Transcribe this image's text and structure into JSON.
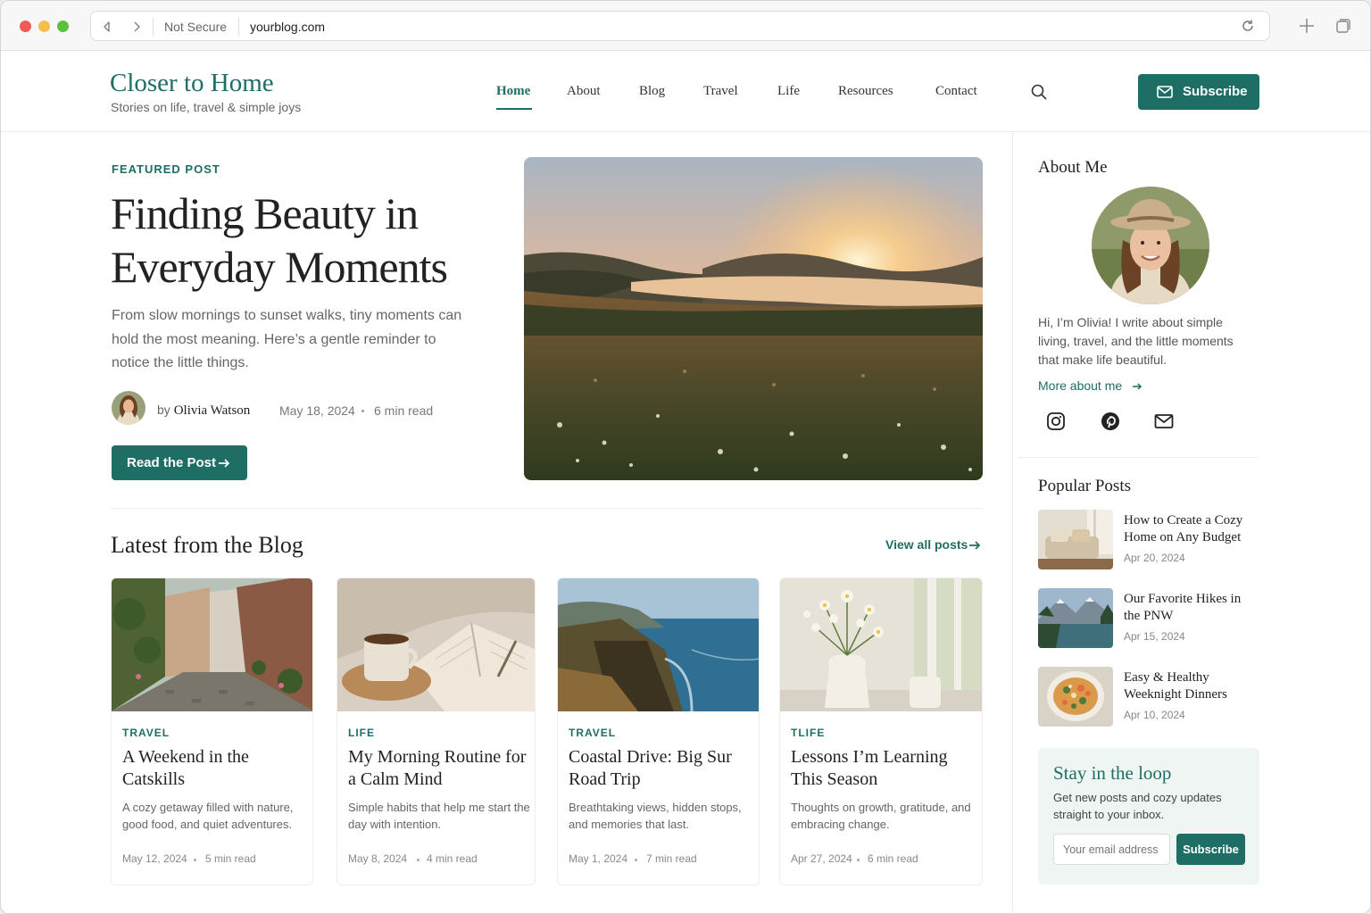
{
  "browser": {
    "security_label": "Not Secure",
    "url": "yourblog.com"
  },
  "site": {
    "title": "Closer to Home",
    "tagline": "Stories on life, travel & simple joys"
  },
  "nav": {
    "items": [
      "Home",
      "About",
      "Blog",
      "Travel",
      "Life",
      "Resources",
      "Contact"
    ],
    "active": "Home",
    "subscribe_label": "Subscribe"
  },
  "featured": {
    "label": "FEATURED POST",
    "title": "Finding Beauty in Everyday Moments",
    "description": "From slow mornings to sunset walks, tiny moments can hold the most meaning. Here’s a gentle reminder to notice the little things.",
    "by": "by",
    "author": "Olivia Watson",
    "date": "May 18, 2024",
    "read_time": "6 min read",
    "button_label": "Read the Post"
  },
  "latest": {
    "heading": "Latest from the Blog",
    "view_all": "View all posts",
    "posts": [
      {
        "category": "TRAVEL",
        "title": "A Weekend in the Catskills",
        "description": "A cozy getaway filled with nature, good food, and quiet adventures.",
        "date": "May 12, 2024",
        "read_time": "5 min read"
      },
      {
        "category": "LIFE",
        "title": "My Morning Routine for a Calm Mind",
        "description": "Simple habits that help me start the day with intention.",
        "date": "May 8, 2024",
        "read_time": "4 min read"
      },
      {
        "category": "TRAVEL",
        "title": "Coastal Drive: Big Sur Road Trip",
        "description": "Breathtaking views, hidden stops, and memories that last.",
        "date": "May 1, 2024",
        "read_time": "7 min read"
      },
      {
        "category": "TLIFE",
        "title": "Lessons I’m Learning This Season",
        "description": "Thoughts on growth, gratitude, and embracing change.",
        "date": "Apr 27, 2024",
        "read_time": "6 min read"
      }
    ]
  },
  "about": {
    "heading": "About Me",
    "text": "Hi, I’m Olivia! I write about simple living, travel, and the little moments that make life beautiful.",
    "more_link": "More about me",
    "social_icons": [
      "instagram-icon",
      "pinterest-icon",
      "mail-icon"
    ]
  },
  "popular": {
    "heading": "Popular Posts",
    "posts": [
      {
        "title": "How to Create a Cozy Home on Any Budget",
        "date": "Apr 20, 2024"
      },
      {
        "title": "Our Favorite Hikes in the PNW",
        "date": "Apr 15, 2024"
      },
      {
        "title": "Easy & Healthy Weeknight Dinners",
        "date": "Apr 10, 2024"
      }
    ]
  },
  "newsletter": {
    "heading": "Stay in the loop",
    "text": "Get new posts and cozy updates straight to your inbox.",
    "placeholder": "Your email address",
    "button_label": "Subscribe"
  },
  "colors": {
    "accent": "#1f6e66",
    "text": "#222222",
    "muted": "#666666"
  }
}
